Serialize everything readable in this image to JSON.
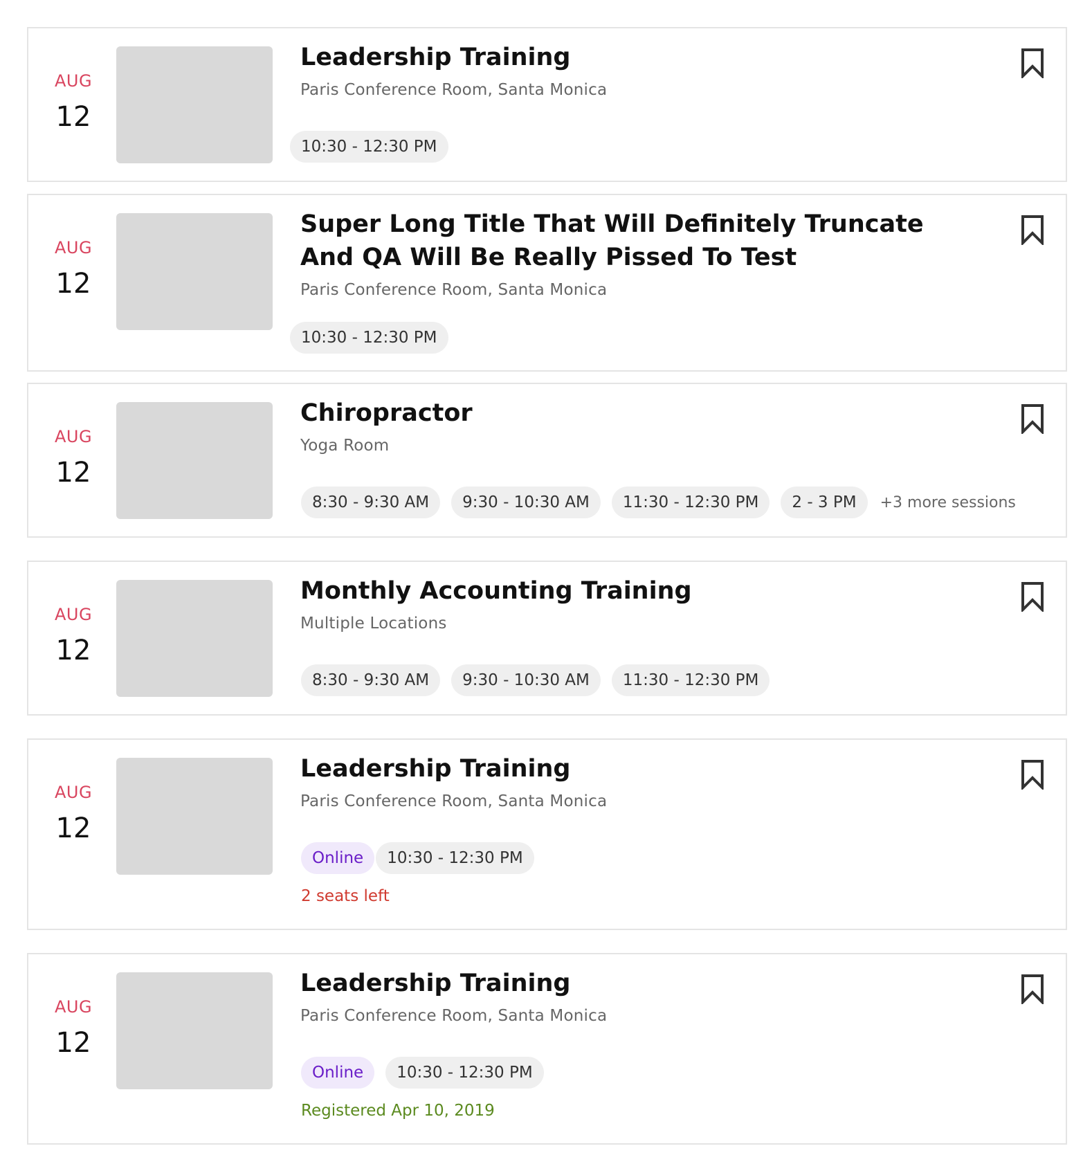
{
  "colors": {
    "month": "#d9455f",
    "online_bg": "#f0e9fb",
    "online_text": "#6a1ec8",
    "seats_left": "#d03a2f",
    "registered": "#5b8a1f",
    "pill_bg": "#efefef",
    "thumbnail": "#d9d9d9"
  },
  "events": [
    {
      "month": "AUG",
      "day": "12",
      "title": "Leadership Training",
      "location": "Paris Conference Room, Santa Monica",
      "online_label": "",
      "sessions": [
        "10:30 - 12:30 PM"
      ],
      "more_sessions": "",
      "status": ""
    },
    {
      "month": "AUG",
      "day": "12",
      "title": "Super Long Title That Will Definitely Truncate And QA Will Be Really Pissed To Test",
      "location": "Paris Conference Room, Santa Monica",
      "online_label": "",
      "sessions": [
        "10:30 - 12:30 PM"
      ],
      "more_sessions": "",
      "status": ""
    },
    {
      "month": "AUG",
      "day": "12",
      "title": "Chiropractor",
      "location": "Yoga Room",
      "online_label": "",
      "sessions": [
        "8:30 - 9:30 AM",
        "9:30 - 10:30 AM",
        "11:30 - 12:30 PM",
        "2 - 3 PM"
      ],
      "more_sessions": "+3 more sessions",
      "status": ""
    },
    {
      "month": "AUG",
      "day": "12",
      "title": "Monthly Accounting Training",
      "location": "Multiple Locations",
      "online_label": "",
      "sessions": [
        "8:30 - 9:30 AM",
        "9:30 - 10:30 AM",
        "11:30 - 12:30 PM"
      ],
      "more_sessions": "",
      "status": ""
    },
    {
      "month": "AUG",
      "day": "12",
      "title": "Leadership Training",
      "location": "Paris Conference Room, Santa Monica",
      "online_label": "Online",
      "sessions": [
        "10:30 - 12:30 PM"
      ],
      "more_sessions": "",
      "status": "2 seats left",
      "status_type": "seats_left"
    },
    {
      "month": "AUG",
      "day": "12",
      "title": "Leadership Training",
      "location": "Paris Conference Room, Santa Monica",
      "online_label": "Online",
      "sessions": [
        "10:30 - 12:30 PM"
      ],
      "more_sessions": "",
      "status": "Registered Apr 10, 2019",
      "status_type": "registered"
    }
  ],
  "icons": {
    "bookmark": "bookmark-icon"
  }
}
